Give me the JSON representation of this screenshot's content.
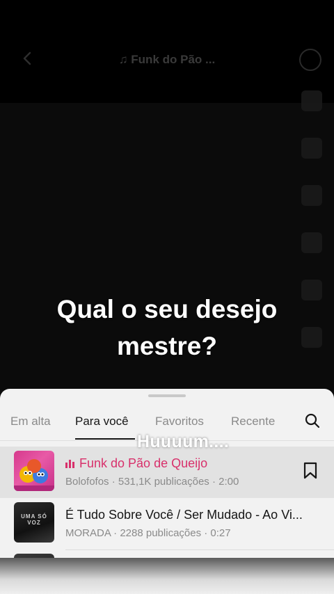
{
  "header": {
    "sound_title": "♫ Funk do Pão ..."
  },
  "video": {
    "caption_line1": "Qual o seu desejo",
    "caption_line2": "mestre?",
    "overlay_text": "Huuuum...."
  },
  "tabs": [
    {
      "label": "Em alta",
      "active": false
    },
    {
      "label": "Para você",
      "active": true
    },
    {
      "label": "Favoritos",
      "active": false
    },
    {
      "label": "Recente",
      "active": false
    }
  ],
  "tracks": [
    {
      "title": "Funk do Pão de Queijo",
      "meta": "Bolofofos · 531,1K publicações · 2:00",
      "playing": true,
      "cover_text": ""
    },
    {
      "title": "É Tudo Sobre Você / Ser Mudado - Ao Vi...",
      "meta": "MORADA · 2288 publicações · 0:27",
      "playing": false,
      "cover_text": "UMA SÓ VOZ"
    }
  ],
  "colors": {
    "accent": "#d8306b",
    "sheet_bg": "#f2f2f2",
    "selected_row": "#e2e2e2"
  }
}
